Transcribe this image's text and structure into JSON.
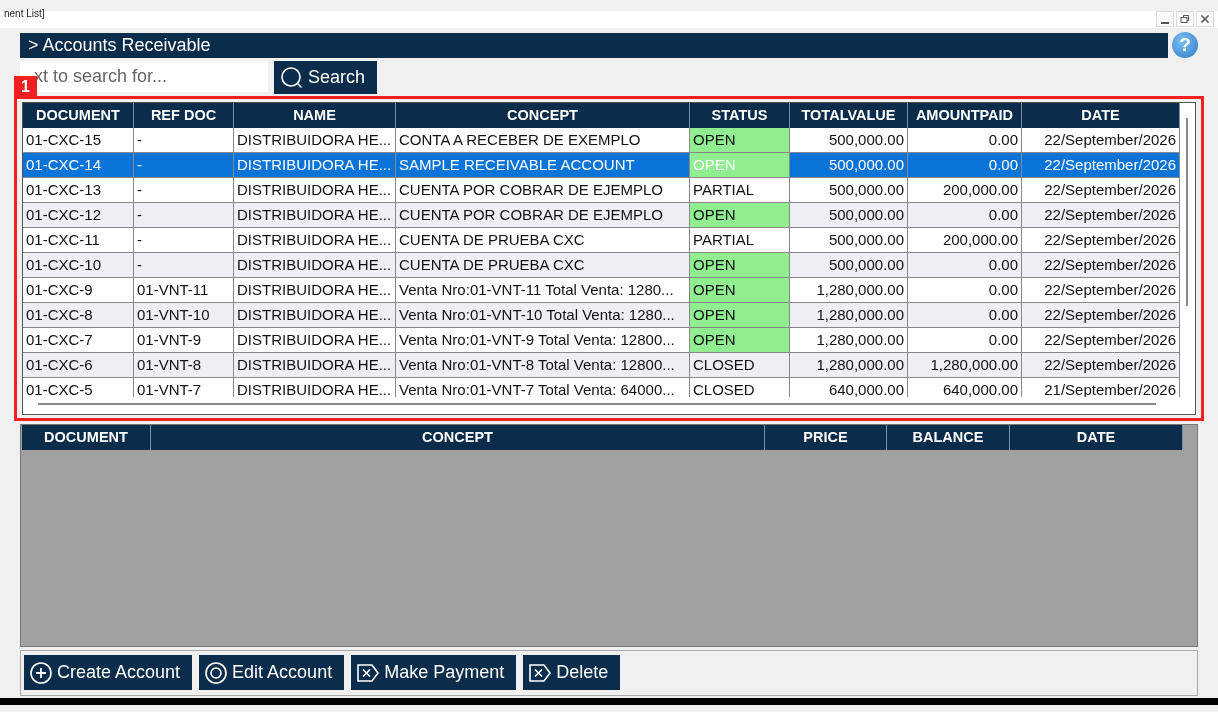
{
  "window": {
    "title": "nent List]"
  },
  "header": {
    "title": "> Accounts Receivable",
    "help": "?"
  },
  "search": {
    "placeholder": "xt to search for...",
    "button": "Search"
  },
  "annotation": {
    "label": "1"
  },
  "table": {
    "columns": [
      "DOCUMENT",
      "REF DOC",
      "NAME",
      "CONCEPT",
      "STATUS",
      "TOTALVALUE",
      "AMOUNTPAID",
      "DATE"
    ],
    "rows": [
      {
        "selected": false,
        "color": "#90ee90",
        "cells": [
          "01-CXC-15",
          "-",
          "DISTRIBUIDORA HE...",
          "CONTA A RECEBER DE EXEMPLO",
          "OPEN",
          "500,000.00",
          "0.00",
          "22/September/2026"
        ]
      },
      {
        "selected": true,
        "color": "#90ee90",
        "cells": [
          "01-CXC-14",
          "-",
          "DISTRIBUIDORA HE...",
          "SAMPLE RECEIVABLE ACCOUNT",
          "OPEN",
          "500,000.00",
          "0.00",
          "22/September/2026"
        ]
      },
      {
        "selected": false,
        "cells": [
          "01-CXC-13",
          "-",
          "DISTRIBUIDORA HE...",
          "CUENTA POR COBRAR DE EJEMPLO",
          "PARTIAL",
          "500,000.00",
          "200,000.00",
          "22/September/2026"
        ]
      },
      {
        "selected": false,
        "color": "#90ee90",
        "cells": [
          "01-CXC-12",
          "-",
          "DISTRIBUIDORA HE...",
          "CUENTA POR COBRAR DE EJEMPLO",
          "OPEN",
          "500,000.00",
          "0.00",
          "22/September/2026"
        ]
      },
      {
        "selected": false,
        "cells": [
          "01-CXC-11",
          "-",
          "DISTRIBUIDORA HE...",
          "CUENTA DE PRUEBA CXC",
          "PARTIAL",
          "500,000.00",
          "200,000.00",
          "22/September/2026"
        ]
      },
      {
        "selected": false,
        "color": "#90ee90",
        "cells": [
          "01-CXC-10",
          "-",
          "DISTRIBUIDORA HE...",
          "CUENTA DE PRUEBA CXC",
          "OPEN",
          "500,000.00",
          "0.00",
          "22/September/2026"
        ]
      },
      {
        "selected": false,
        "color": "#90ee90",
        "cells": [
          "01-CXC-9",
          "01-VNT-11",
          "DISTRIBUIDORA HE...",
          "Venta Nro:01-VNT-11 Total Venta: 1280...",
          "OPEN",
          "1,280,000.00",
          "0.00",
          "22/September/2026"
        ]
      },
      {
        "selected": false,
        "color": "#90ee90",
        "cells": [
          "01-CXC-8",
          "01-VNT-10",
          "DISTRIBUIDORA HE...",
          "Venta Nro:01-VNT-10 Total Venta: 1280...",
          "OPEN",
          "1,280,000.00",
          "0.00",
          "22/September/2026"
        ]
      },
      {
        "selected": false,
        "color": "#90ee90",
        "cells": [
          "01-CXC-7",
          "01-VNT-9",
          "DISTRIBUIDORA HE...",
          "Venta Nro:01-VNT-9 Total Venta: 12800...",
          "OPEN",
          "1,280,000.00",
          "0.00",
          "22/September/2026"
        ]
      },
      {
        "selected": false,
        "cells": [
          "01-CXC-6",
          "01-VNT-8",
          "DISTRIBUIDORA HE...",
          "Venta Nro:01-VNT-8 Total Venta: 12800...",
          "CLOSED",
          "1,280,000.00",
          "1,280,000.00",
          "22/September/2026"
        ]
      },
      {
        "selected": false,
        "cells": [
          "01-CXC-5",
          "01-VNT-7",
          "DISTRIBUIDORA HE...",
          "Venta Nro:01-VNT-7 Total Venta: 64000...",
          "CLOSED",
          "640,000.00",
          "640,000.00",
          "21/September/2026"
        ]
      }
    ]
  },
  "detail_table": {
    "columns": [
      "DOCUMENT",
      "CONCEPT",
      "PRICE",
      "BALANCE",
      "DATE"
    ]
  },
  "buttons": [
    "Create Account",
    "Edit Account",
    "Make Payment",
    "Delete"
  ]
}
